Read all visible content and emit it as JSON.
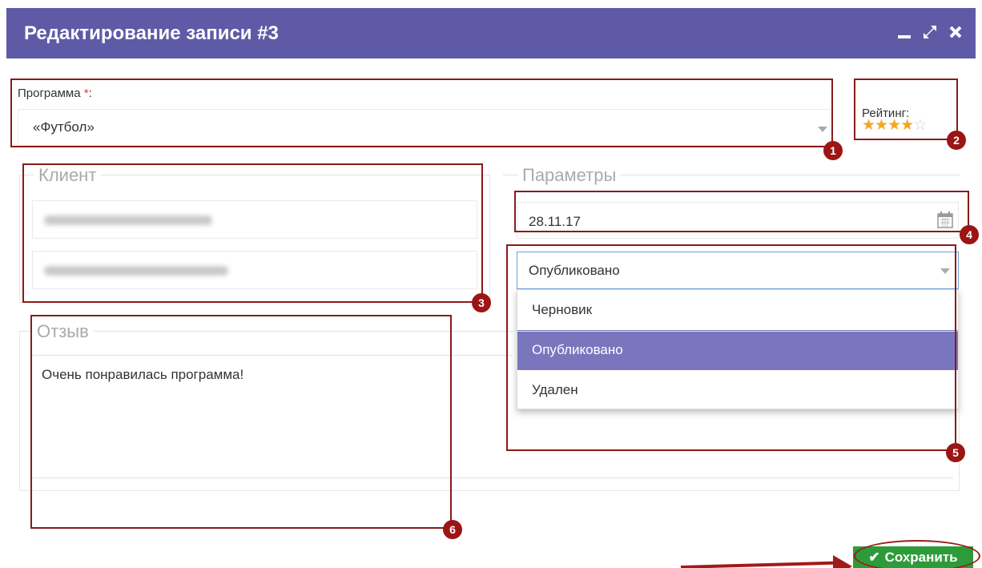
{
  "header": {
    "title": "Редактирование записи #3",
    "minimize_icon": "minimize-icon",
    "expand_icon": "expand-icon",
    "close_icon": "close-icon",
    "color": "#5f5aa6"
  },
  "program": {
    "label": "Программа",
    "required_mark": "*",
    "label_suffix": ":",
    "value": "«Футбол»"
  },
  "rating": {
    "label": "Рейтинг:",
    "value": 4,
    "max": 5
  },
  "client": {
    "legend": "Клиент"
  },
  "params": {
    "legend": "Параметры",
    "date": "28.11.17",
    "status_value": "Опубликовано",
    "status_options": [
      "Черновик",
      "Опубликовано",
      "Удален"
    ],
    "selected_index": 1
  },
  "review": {
    "legend": "Отзыв",
    "text": "Очень понравилась программа!"
  },
  "save_button": {
    "label": "Сохранить",
    "color": "#2e9b3a"
  },
  "annotations": [
    "1",
    "2",
    "3",
    "4",
    "5",
    "6"
  ]
}
